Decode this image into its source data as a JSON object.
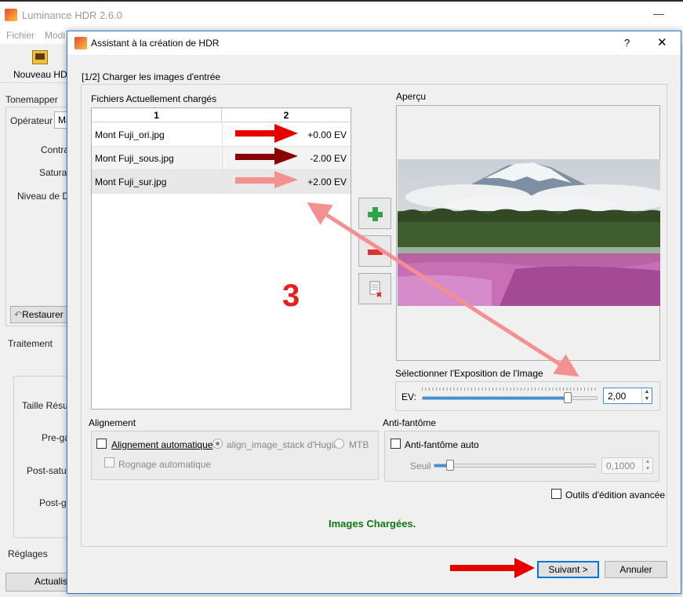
{
  "main_window": {
    "title": "Luminance HDR 2.6.0",
    "menu": [
      "Fichier",
      "Modi"
    ],
    "toolbar": {
      "new_hdr": "Nouveau HDR"
    },
    "left_panel": {
      "tonemapper": "Tonemapper",
      "operator_label": "Opérateur",
      "operator_value": "Ma",
      "contrast": "Contra",
      "saturation": "Saturat",
      "detail_level": "Niveau de Dé",
      "restore": "Restaurer",
      "processing": "Traitement",
      "result_size": "Taille Résult",
      "pre_gamma": "Pre-ga",
      "post_saturation": "Post-satur",
      "post_gamma": "Post-ga",
      "settings": "Réglages",
      "update": "Actualise"
    }
  },
  "dialog": {
    "title": "Assistant à la création de HDR",
    "help": "?",
    "close": "✕",
    "step": "[1/2] Charger les images d'entrée",
    "files": {
      "label": "Fichiers Actuellement chargés",
      "columns": [
        "1",
        "2"
      ],
      "rows": [
        {
          "name": "Mont Fuji_ori.jpg",
          "ev": "+0.00 EV",
          "arrow_color": "#e60000"
        },
        {
          "name": "Mont Fuji_sous.jpg",
          "ev": "-2.00 EV",
          "arrow_color": "#8b0000"
        },
        {
          "name": "Mont Fuji_sur.jpg",
          "ev": "+2.00 EV",
          "arrow_color": "#f39090"
        }
      ]
    },
    "preview": {
      "label": "Aperçu"
    },
    "exposure": {
      "label": "Sélectionner l'Exposition de l'Image",
      "ev_label": "EV:",
      "value": "2,00",
      "slider_fraction": 0.83
    },
    "alignment": {
      "label": "Alignement",
      "auto_align": "Alignement automatique",
      "option_hugin": "align_image_stack d'Hugin",
      "option_mtb": "MTB",
      "auto_crop": "Rognage automatique"
    },
    "antighost": {
      "label": "Anti-fantôme",
      "auto": "Anti-fantôme auto",
      "threshold_label": "Seuil",
      "threshold_value": "0,1000",
      "slider_fraction": 0.1
    },
    "advanced": "Outils d'édition avancée",
    "status": "Images Chargées.",
    "buttons": {
      "next": "Suivant >",
      "cancel": "Annuler"
    }
  },
  "annotation": {
    "number": "3",
    "arrow_color": "#f39090",
    "main_arrow_color": "#e60000"
  }
}
